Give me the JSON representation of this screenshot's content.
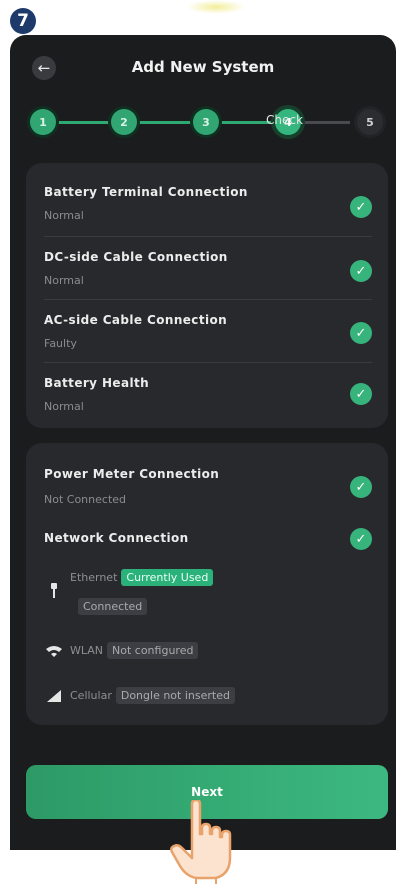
{
  "step_badge": "7",
  "header": {
    "title": "Add New System",
    "back_icon": "arrow-left-icon"
  },
  "stepper": {
    "steps": [
      "1",
      "2",
      "3",
      "4",
      "5"
    ],
    "current": 4,
    "current_label": "Check"
  },
  "checks": [
    {
      "title": "Battery Terminal Connection",
      "status": "Normal"
    },
    {
      "title": "DC-side Cable Connection",
      "status": "Normal"
    },
    {
      "title": "AC-side Cable Connection",
      "status": "Faulty"
    },
    {
      "title": "Battery Health",
      "status": "Normal"
    }
  ],
  "connections": {
    "power_meter": {
      "title": "Power Meter Connection",
      "status": "Not Connected"
    },
    "network": {
      "title": "Network Connection"
    },
    "ethernet": {
      "label": "Ethernet",
      "badge": "Currently Used",
      "status": "Connected"
    },
    "wlan": {
      "label": "WLAN",
      "status": "Not configured"
    },
    "cellular": {
      "label": "Cellular",
      "status": "Dongle not inserted"
    }
  },
  "next_button": "Next",
  "colors": {
    "accent": "#36b47c",
    "background": "#1b1c1e",
    "card": "#28292d"
  }
}
